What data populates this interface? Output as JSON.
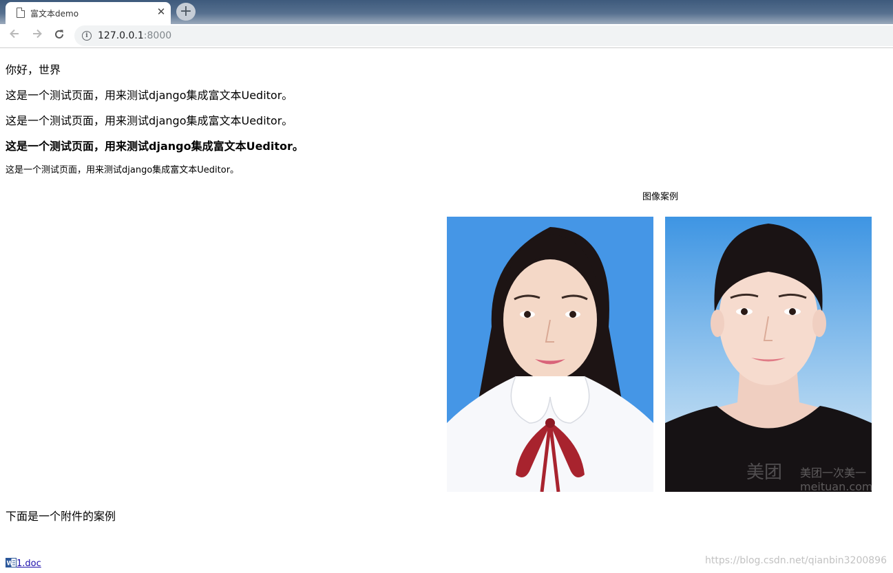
{
  "browser": {
    "tab_title": "富文本demo",
    "tab_close": "✕",
    "new_tab": "+",
    "url_host": "127.0.0.1",
    "url_port": ":8000"
  },
  "page": {
    "greeting": "你好，世界",
    "paragraphs": [
      "这是一个测试页面，用来测试django集成富文本Ueditor。",
      "这是一个测试页面，用来测试django集成富文本Ueditor。",
      "这是一个测试页面，用来测试django集成富文本Ueditor。",
      "这是一个测试页面，用来测试django集成富文本Ueditor。"
    ],
    "image_caption": "图像案例",
    "photo_watermark_line1": "美团一次美一",
    "photo_watermark_line2": "meituan.com",
    "attachment_heading": "下面是一个附件的案例",
    "attachment_link": "1.doc"
  },
  "overlay": {
    "watermark": "https://blog.csdn.net/qianbin3200896"
  },
  "colors": {
    "tabstrip": "#3e5a7c",
    "photo_bg_blue": "#4596e6",
    "link": "#1a0dab"
  }
}
